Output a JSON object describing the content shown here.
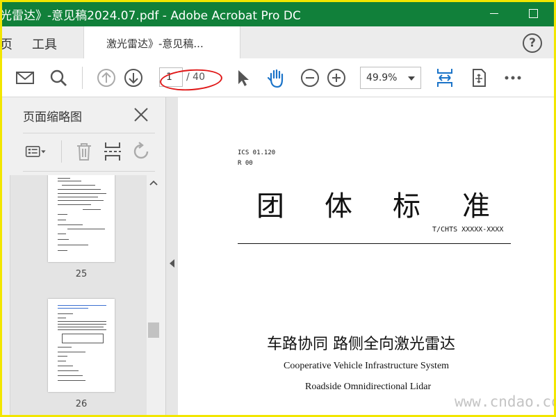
{
  "window": {
    "title": "光雷达》-意见稿2024.07.pdf - Adobe Acrobat Pro DC"
  },
  "tabs": {
    "home_partial": "页",
    "tools": "工具",
    "document": "激光雷达》-意见稿..."
  },
  "help": {
    "label": "?"
  },
  "toolbar": {
    "page_current": "1",
    "page_total": "/ 40",
    "zoom": "49.9%"
  },
  "panel": {
    "title": "页面缩略图",
    "thumbnails": [
      {
        "page": "25"
      },
      {
        "page": "26"
      }
    ]
  },
  "document": {
    "ics": "ICS 01.120",
    "r": "R 00",
    "heading_chars": [
      "团",
      "体",
      "标",
      "准"
    ],
    "standard_number": "T/CHTS XXXXX-XXXX",
    "title_cn": "车路协同 路侧全向激光雷达",
    "title_en_1": "Cooperative Vehicle Infrastructure System",
    "title_en_2": "Roadside Omnidirectional Lidar"
  },
  "watermark": "www.cndao.com",
  "colors": {
    "titlebar": "#11803a",
    "accent_blue": "#1a73c8",
    "annotation_red": "#e01818",
    "frame_yellow": "#f2e600"
  },
  "icons": [
    "email-icon",
    "search-icon",
    "prev-page-icon",
    "next-page-icon",
    "select-cursor-icon",
    "hand-tool-icon",
    "zoom-out-icon",
    "zoom-in-icon",
    "fit-page-icon",
    "rotate-view-icon",
    "more-icon",
    "options-icon",
    "delete-icon",
    "insert-page-icon",
    "undo-icon"
  ]
}
